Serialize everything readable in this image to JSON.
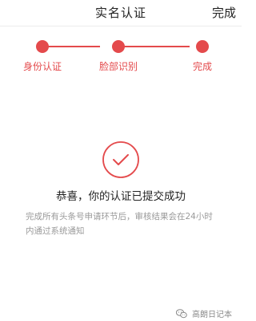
{
  "nav": {
    "title": "实名认证",
    "done_label": "完成"
  },
  "steps": {
    "items": [
      {
        "label": "身份认证",
        "status": "done"
      },
      {
        "label": "脸部识别",
        "status": "done"
      },
      {
        "label": "完成",
        "status": "done"
      }
    ]
  },
  "result": {
    "icon": "check-circle-icon",
    "title": "恭喜，你的认证已提交成功",
    "description": "完成所有头条号申请环节后，审核结果会在24小时内通过系统通知"
  },
  "watermark": {
    "icon": "wechat-icon",
    "text": "高朗日记本"
  },
  "colors": {
    "accent": "#e44a4c",
    "text": "#222222",
    "muted": "#9a9a9a"
  }
}
